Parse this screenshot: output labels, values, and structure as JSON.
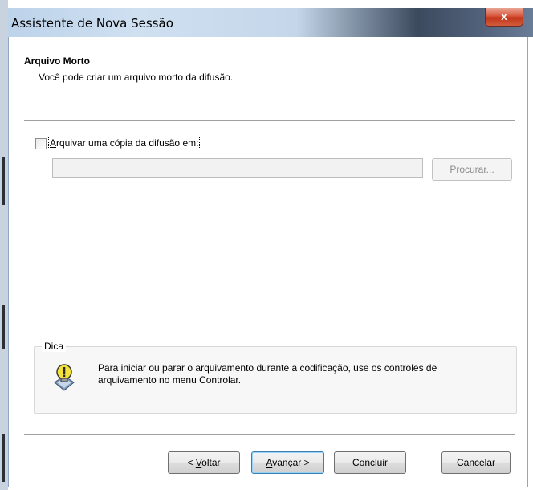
{
  "window": {
    "title": "Assistente de Nova Sessão",
    "close_label": "x"
  },
  "header": {
    "title": "Arquivo Morto",
    "subtitle": "Você pode criar um arquivo morto da difusão."
  },
  "archive": {
    "checkbox_label": "Arquivar uma cópia da difusão em:",
    "checked": false,
    "path_value": "",
    "browse_label": "Procurar..."
  },
  "tip": {
    "title": "Dica",
    "text": "Para iniciar ou parar o arquivamento durante a codificação, use os controles de arquivamento no menu Controlar.",
    "icon": "lightbulb-tip-icon"
  },
  "buttons": {
    "back": "< Voltar",
    "next": "Avançar >",
    "finish": "Concluir",
    "cancel": "Cancelar"
  },
  "colors": {
    "close": "#d9573e",
    "default_button_border": "#3c7fb1"
  }
}
